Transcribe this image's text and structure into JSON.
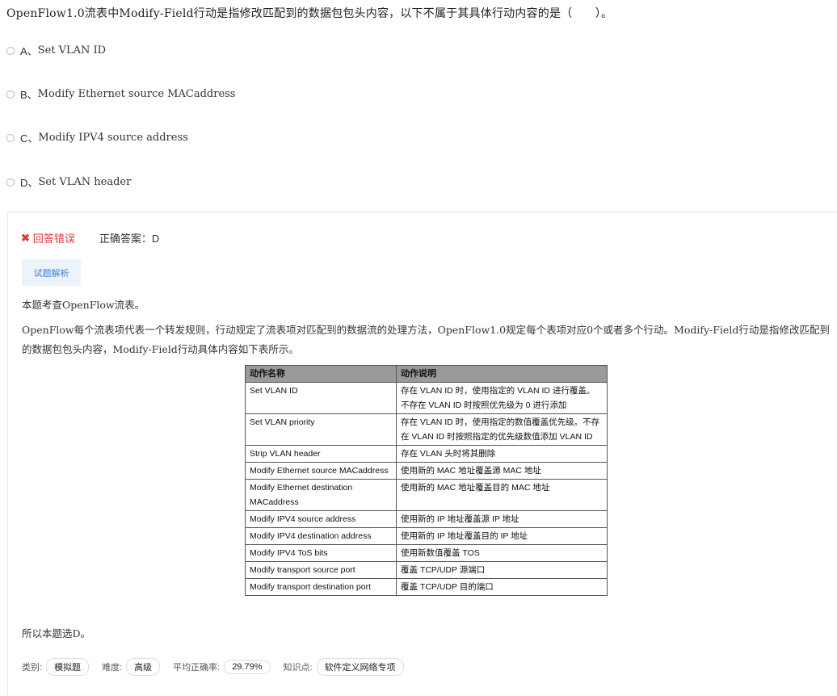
{
  "question": {
    "text": "OpenFlow1.0流表中Modify-Field行动是指修改匹配到的数据包包头内容，以下不属于其具体行动内容的是（　　）。"
  },
  "options": [
    {
      "letter": "A、",
      "text": "Set VLAN ID"
    },
    {
      "letter": "B、",
      "text": "Modify Ethernet source MACaddress"
    },
    {
      "letter": "C、",
      "text": "Modify IPV4 source address"
    },
    {
      "letter": "D、",
      "text": "Set VLAN header"
    }
  ],
  "result": {
    "wrong_icon": "✖",
    "wrong_label": "回答错误",
    "correct_label": "正确答案：D"
  },
  "analysis_button": "试题解析",
  "analysis": {
    "p1": "本题考查OpenFlow流表。",
    "p2": "OpenFlow每个流表项代表一个转发规则，行动规定了流表项对匹配到的数据流的处理方法，OpenFlow1.0规定每个表项对应0个或者多个行动。Modify-Field行动是指修改匹配到的数据包包头内容，Modify-Field行动具体内容如下表所示。",
    "conclusion": "所以本题选D。"
  },
  "table": {
    "headers": [
      "动作名称",
      "动作说明"
    ],
    "rows": [
      [
        "Set VLAN ID",
        "存在 VLAN ID 时，使用指定的 VLAN ID 进行覆盖。不存在 VLAN ID 时按照优先级为 0 进行添加"
      ],
      [
        "Set VLAN priority",
        "存在 VLAN ID 时，使用指定的数值覆盖优先级。不存在 VLAN ID 时按照指定的优先级数值添加 VLAN ID"
      ],
      [
        "Strip VLAN header",
        "存在 VLAN 头时将其删除"
      ],
      [
        "Modify Ethernet source MACaddress",
        "使用新的 MAC 地址覆盖源 MAC 地址"
      ],
      [
        "Modify Ethernet destination MACaddress",
        "使用新的 MAC 地址覆盖目的 MAC 地址"
      ],
      [
        "Modify IPV4 source address",
        "使用新的 IP 地址覆盖源 IP 地址"
      ],
      [
        "Modify IPV4 destination address",
        "使用新的 IP 地址覆盖目的 IP 地址"
      ],
      [
        "Modify IPV4 ToS bits",
        "使用新数值覆盖 TOS"
      ],
      [
        "Modify transport source port",
        "覆盖 TCP/UDP 源端口"
      ],
      [
        "Modify transport destination port",
        "覆盖 TCP/UDP 目的端口"
      ]
    ]
  },
  "footer": {
    "category_label": "类别:",
    "category_value": "模拟题",
    "difficulty_label": "难度:",
    "difficulty_value": "高级",
    "accuracy_label": "平均正确率:",
    "accuracy_value": "29.79%",
    "topic_label": "知识点:",
    "topic_value": "软件定义网络专项"
  }
}
